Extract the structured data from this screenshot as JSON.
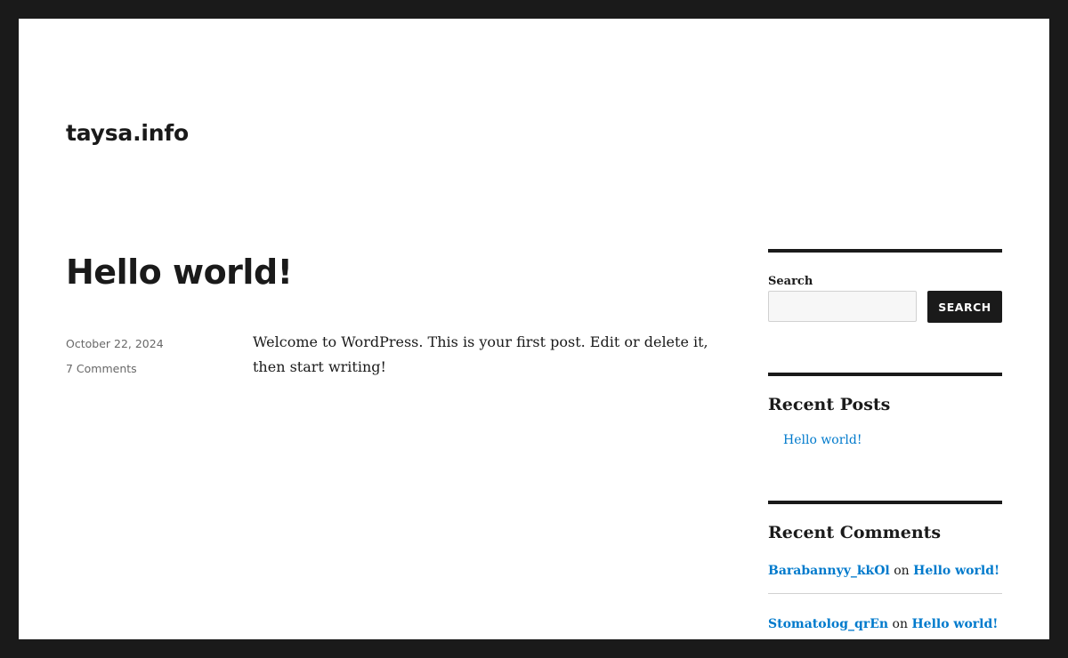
{
  "site": {
    "title": "taysa.info"
  },
  "post": {
    "title": "Hello world!",
    "date": "October 22, 2024",
    "comments_link": "7 Comments",
    "content": "Welcome to WordPress. This is your first post. Edit or delete it, then start writing!"
  },
  "sidebar": {
    "search": {
      "label": "Search",
      "value": "",
      "button_label": "SEARCH"
    },
    "recent_posts": {
      "title": "Recent Posts",
      "items": [
        "Hello world!"
      ]
    },
    "recent_comments": {
      "title": "Recent Comments",
      "items": [
        {
          "author": "Barabannyy_kkOl",
          "connector": "on",
          "post": "Hello world!"
        },
        {
          "author": "Stomatolog_qrEn",
          "connector": "on",
          "post": "Hello world!"
        }
      ]
    }
  },
  "colors": {
    "frame": "#1a1a1a",
    "text": "#1a1a1a",
    "link": "#007acc",
    "meta": "#686868"
  }
}
